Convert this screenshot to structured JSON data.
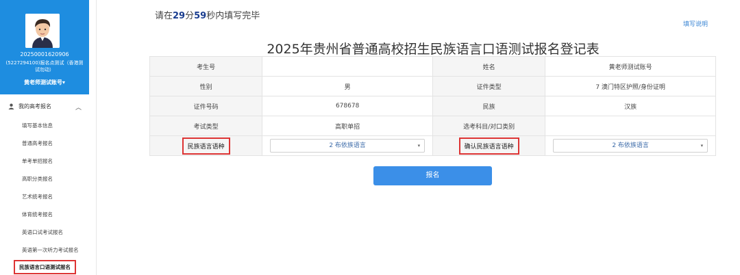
{
  "sidebar": {
    "user_id": "20250001620906",
    "user_sub": "(5227294100)报名点测试（香港测试勿动）",
    "user_name": "黄老师测试账号",
    "user_caret": "▾",
    "section_title": "我的高考报名",
    "section_chevron": "︿",
    "items": [
      {
        "label": "填写基本信息"
      },
      {
        "label": "普通高考报名"
      },
      {
        "label": "单考单招报名"
      },
      {
        "label": "高职分类报名"
      },
      {
        "label": "艺术统考报名"
      },
      {
        "label": "体育统考报名"
      },
      {
        "label": "英语口试考试报名"
      },
      {
        "label": "英语第一次听力考试报名"
      },
      {
        "label": "民族语言口语测试报名"
      }
    ]
  },
  "timer": {
    "prefix": "请在",
    "minutes": "29",
    "min_unit": "分",
    "seconds": "59",
    "suffix": "秒内填写完毕"
  },
  "help_link": "填写说明",
  "title": "2025年贵州省普通高校招生民族语言口语测试报名登记表",
  "form": {
    "row1": {
      "l1": "考生号",
      "v1": "",
      "l2": "姓名",
      "v2": "黄老师测试账号"
    },
    "row2": {
      "l1": "性别",
      "v1": "男",
      "l2": "证件类型",
      "v2": "7 澳门特区护照/身份证明"
    },
    "row3": {
      "l1": "证件号码",
      "v1": "678678",
      "l2": "民族",
      "v2": "汉族"
    },
    "row4": {
      "l1": "考试类型",
      "v1": "高职单招",
      "l2": "选考科目/对口类别",
      "v2": ""
    },
    "row5": {
      "l1": "民族语言语种",
      "v1": "2 布依族语言",
      "l2": "确认民族语言语种",
      "v2": "2 布依族语言"
    }
  },
  "select_caret": "▾",
  "submit_label": "报名",
  "colors": {
    "sidebar_blue": "#1e8de0",
    "accent": "#3b8fe8",
    "highlight": "#dd3333"
  }
}
